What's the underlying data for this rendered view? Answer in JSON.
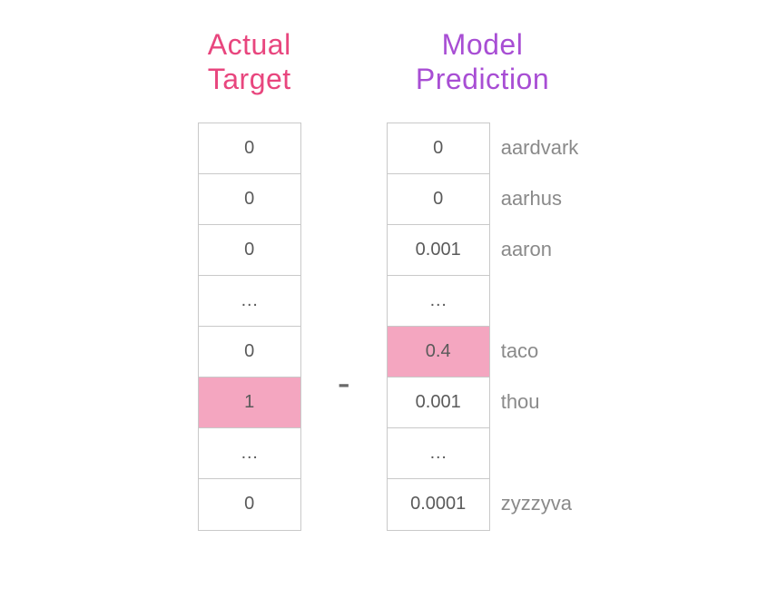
{
  "left": {
    "title_line1": "Actual",
    "title_line2": "Target",
    "cells": [
      {
        "value": "0",
        "highlight": false
      },
      {
        "value": "0",
        "highlight": false
      },
      {
        "value": "0",
        "highlight": false
      },
      {
        "value": "…",
        "highlight": false
      },
      {
        "value": "0",
        "highlight": false
      },
      {
        "value": "1",
        "highlight": true
      },
      {
        "value": "…",
        "highlight": false
      },
      {
        "value": "0",
        "highlight": false
      }
    ]
  },
  "operator": "-",
  "right": {
    "title_line1": "Model",
    "title_line2": "Prediction",
    "cells": [
      {
        "value": "0",
        "highlight": false,
        "label": "aardvark"
      },
      {
        "value": "0",
        "highlight": false,
        "label": "aarhus"
      },
      {
        "value": "0.001",
        "highlight": false,
        "label": "aaron"
      },
      {
        "value": "…",
        "highlight": false,
        "label": ""
      },
      {
        "value": "0.4",
        "highlight": true,
        "label": "taco"
      },
      {
        "value": "0.001",
        "highlight": false,
        "label": "thou"
      },
      {
        "value": "…",
        "highlight": false,
        "label": ""
      },
      {
        "value": "0.0001",
        "highlight": false,
        "label": "zyzzyva"
      }
    ]
  }
}
